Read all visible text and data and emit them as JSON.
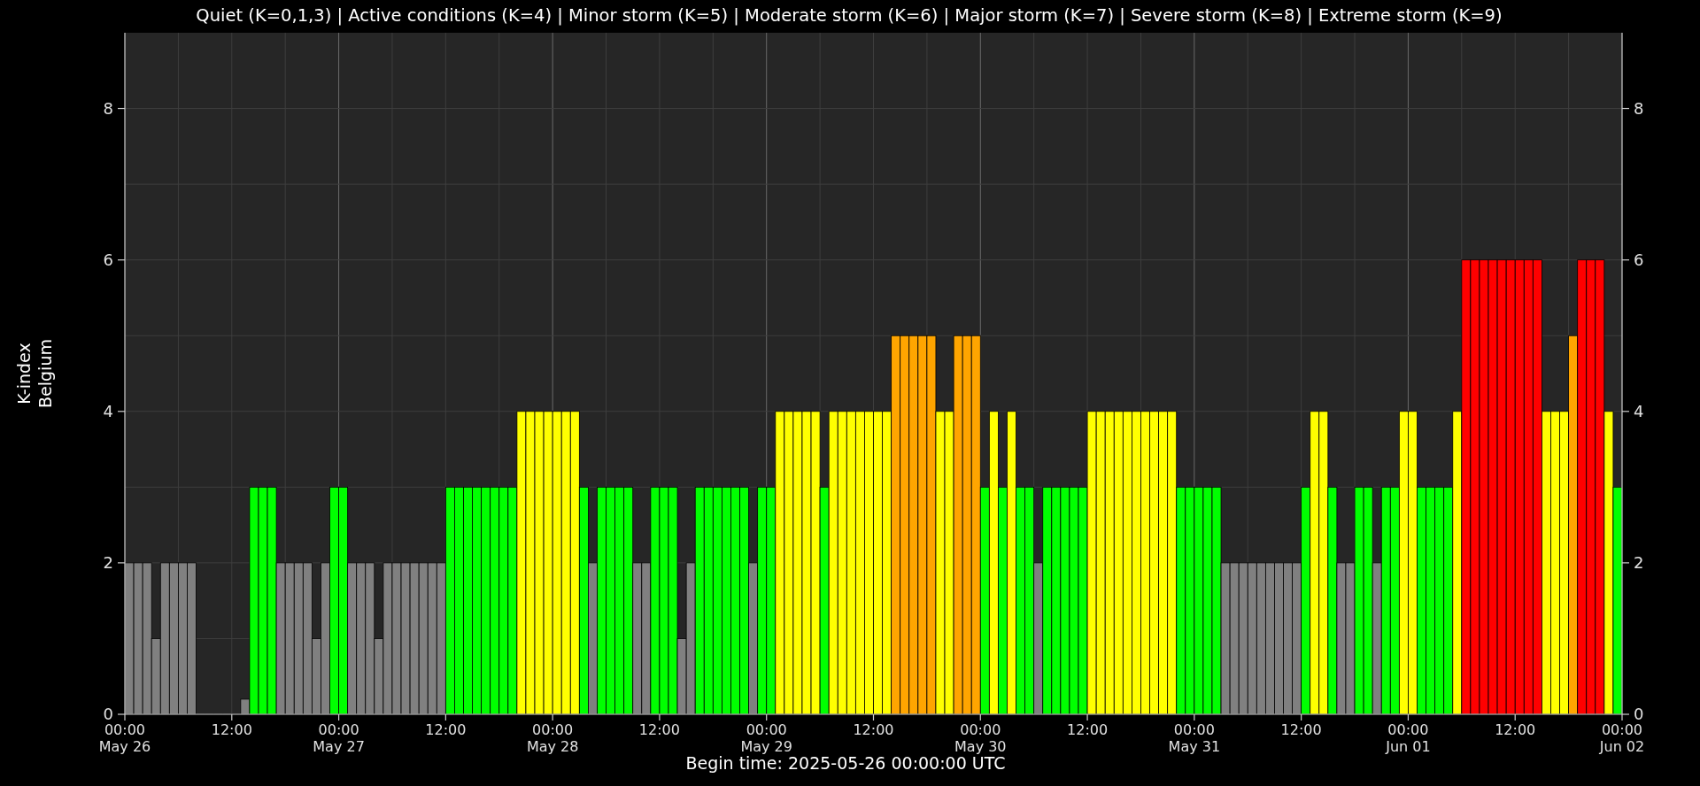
{
  "chart_data": {
    "type": "bar",
    "title": "Quiet (K=0,1,3) | Active conditions (K=4) | Minor storm (K=5) | Moderate storm (K=6) | Major storm (K=7) | Severe storm (K=8) | Extreme storm (K=9)",
    "xlabel": "Begin time: 2025-05-26 00:00:00 UTC",
    "ylabel": "K-index\nBelgium",
    "ylim": [
      0,
      9
    ],
    "yticks": [
      0,
      2,
      4,
      6,
      8
    ],
    "y2ticks": [
      0,
      2,
      4,
      6,
      8
    ],
    "y2lim": [
      0,
      9
    ],
    "grid": true,
    "categories": [
      "00:00\nMay 26",
      null,
      null,
      null,
      null,
      null,
      null,
      null,
      null,
      null,
      null,
      null,
      "12:00",
      null,
      null,
      null,
      null,
      null,
      null,
      null,
      null,
      null,
      null,
      null,
      "00:00\nMay 27",
      null,
      null,
      null,
      null,
      null,
      null,
      null,
      null,
      null,
      null,
      null,
      "12:00",
      null,
      null,
      null,
      null,
      null,
      null,
      null,
      null,
      null,
      null,
      null,
      "00:00\nMay 28",
      null,
      null,
      null,
      null,
      null,
      null,
      null,
      null,
      null,
      null,
      null,
      "12:00",
      null,
      null,
      null,
      null,
      null,
      null,
      null,
      null,
      null,
      null,
      null,
      "00:00\nMay 29",
      null,
      null,
      null,
      null,
      null,
      null,
      null,
      null,
      null,
      null,
      null,
      "12:00",
      null,
      null,
      null,
      null,
      null,
      null,
      null,
      null,
      null,
      null,
      null,
      "00:00\nMay 30",
      null,
      null,
      null,
      null,
      null,
      null,
      null,
      null,
      null,
      null,
      null,
      "12:00",
      null,
      null,
      null,
      null,
      null,
      null,
      null,
      null,
      null,
      null,
      null,
      "00:00\nMay 31",
      null,
      null,
      null,
      null,
      null,
      null,
      null,
      null,
      null,
      null,
      null,
      "12:00",
      null,
      null,
      null,
      null,
      null,
      null,
      null,
      null,
      null,
      null,
      null,
      "00:00\nJun 01",
      null,
      null,
      null,
      null,
      null,
      null,
      null,
      null,
      null,
      null,
      null,
      "12:00",
      null,
      null,
      null,
      null,
      null,
      null,
      null,
      null,
      null,
      null,
      null,
      "00:00\nJun 02"
    ],
    "series": [
      {
        "values": [
          2,
          2,
          2,
          1,
          2,
          2,
          2,
          2,
          0,
          0,
          0,
          0,
          0,
          0.2,
          3,
          3,
          3,
          2,
          2,
          2,
          2,
          1,
          2,
          3,
          3,
          2,
          2,
          2,
          1,
          2,
          2,
          2,
          2,
          2,
          2,
          2,
          3,
          3,
          3,
          3,
          3,
          3,
          3,
          3,
          4,
          4,
          4,
          4,
          4,
          4,
          4,
          3,
          2,
          3,
          3,
          3,
          3,
          2,
          2,
          3,
          3,
          3,
          1,
          2,
          3,
          3,
          3,
          3,
          3,
          3,
          2,
          3,
          3,
          4,
          4,
          4,
          4,
          4,
          3,
          4,
          4,
          4,
          4,
          4,
          4,
          4,
          5,
          5,
          5,
          5,
          5,
          4,
          4,
          5,
          5,
          5,
          3,
          4,
          3,
          4,
          3,
          3,
          2,
          3,
          3,
          3,
          3,
          3,
          4,
          4,
          4,
          4,
          4,
          4,
          4,
          4,
          4,
          4,
          3,
          3,
          3,
          3,
          3,
          2,
          2,
          2,
          2,
          2,
          2,
          2,
          2,
          2,
          3,
          4,
          4,
          3,
          2,
          2,
          3,
          3,
          2,
          3,
          3,
          4,
          4,
          3,
          3,
          3,
          3,
          4,
          6,
          6,
          6,
          6,
          6,
          6,
          6,
          6,
          6,
          4,
          4,
          4,
          5,
          6,
          6,
          6,
          4,
          3,
          null
        ]
      }
    ]
  }
}
